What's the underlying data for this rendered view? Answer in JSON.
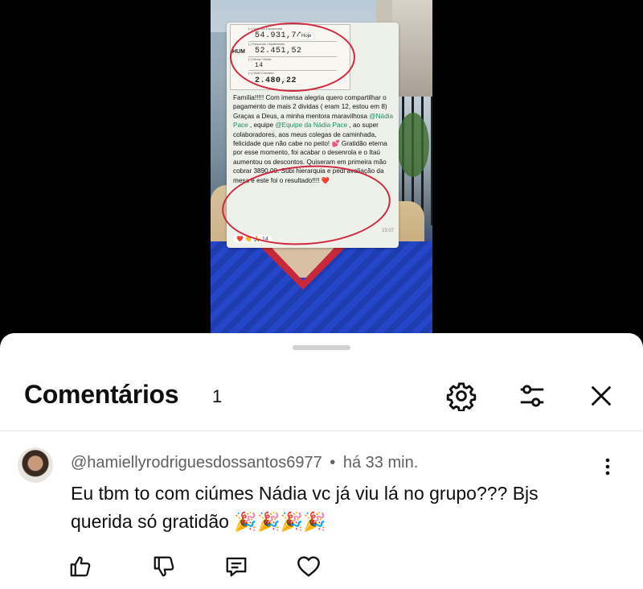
{
  "video": {
    "receipt": {
      "label_document": "(=) Valor do Documento",
      "value_document": "54.931,74",
      "label_discount": "(-) Desconto / Abatimento",
      "value_discount": "52.451,52",
      "label_fine": "(+) Mora / Multa",
      "value_fine": "14",
      "label_charged": "(=) Valor Cobrado",
      "value_charged": "2.480,22",
      "bank_fragment": "HUM",
      "date_chip": "Hoje"
    },
    "message": {
      "part1": "Família!!!!! Com imensa alegria quero compartilhar o pagamento de mais 2 dividas ( eram 12, estou em 8) Graças a Deus, a minha mentora maravilhosa ",
      "mention1": "@Nádia Pace",
      "part2": " , equipe ",
      "mention2": "@Equipe da Nádia Pace",
      "part3": " , ao super colaboradores, aos meus colegas de caminhada, felicidade que não cabe no peito! 💕 Gratidão eterna por esse momento, foi acabar o desenrola e o Itaú aumentou os descontos. Quiseram em primeira mão cobrar 3890,00. Subi hierarquia e pedi avaliação da mesa e este foi o resultado!!!! ❤️",
      "time": "15:07",
      "reactions": "❤️ 👏 🙏 14"
    }
  },
  "comments": {
    "title": "Comentários",
    "count": "1",
    "items": [
      {
        "author": "@hamiellyrodriguesdossantos6977",
        "separator": "•",
        "time": "há 33 min.",
        "text": "Eu tbm to com ciúmes Nádia vc já viu lá no grupo??? Bjs querida só gratidão 🎉🎉🎉🎉"
      }
    ]
  },
  "icons": {
    "settings": "gear-icon",
    "filter": "sliders-icon",
    "close": "close-icon",
    "more": "kebab-icon",
    "like": "thumbs-up-icon",
    "dislike": "thumbs-down-icon",
    "reply": "reply-icon",
    "heart": "heart-icon"
  },
  "colors": {
    "text_primary": "#0f0f0f",
    "text_secondary": "#606060",
    "annotation_red": "#d0283e",
    "mention_green": "#1c8e5b"
  }
}
